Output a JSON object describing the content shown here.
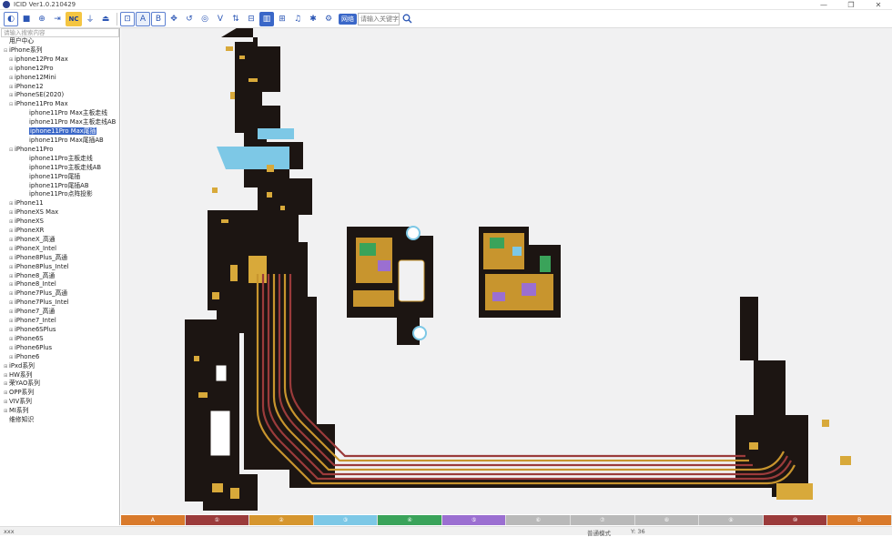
{
  "window": {
    "title": "ICID Ver1.0.210429",
    "buttons": {
      "minimize": "—",
      "restore": "❐",
      "close": "✕"
    }
  },
  "toolbar": {
    "items": [
      {
        "name": "app-logo-icon",
        "glyph": "◐"
      },
      {
        "name": "stop-icon",
        "glyph": "■"
      },
      {
        "name": "ground-icon",
        "glyph": "⊕"
      },
      {
        "name": "trace-icon",
        "glyph": "⇥"
      },
      {
        "name": "nc-button",
        "glyph": "NC"
      },
      {
        "name": "ground-symbol-icon",
        "glyph": "⏚"
      },
      {
        "name": "layer-up-icon",
        "glyph": "⏏"
      },
      {
        "name": "select-icon",
        "glyph": "⊡"
      },
      {
        "name": "side-a-button",
        "glyph": "A"
      },
      {
        "name": "side-b-button",
        "glyph": "B"
      },
      {
        "name": "move-icon",
        "glyph": "✥"
      },
      {
        "name": "rotate-icon",
        "glyph": "↺"
      },
      {
        "name": "target-icon",
        "glyph": "◎"
      },
      {
        "name": "voltage-icon",
        "glyph": "V"
      },
      {
        "name": "swap-icon",
        "glyph": "⇅"
      },
      {
        "name": "component-icon",
        "glyph": "⊟"
      },
      {
        "name": "layers-icon",
        "glyph": "▥"
      },
      {
        "name": "filter-icon",
        "glyph": "⊞"
      },
      {
        "name": "headphone-icon",
        "glyph": "♫"
      },
      {
        "name": "bluetooth-icon",
        "glyph": "✱"
      },
      {
        "name": "settings-icon",
        "glyph": "⚙"
      }
    ],
    "keyword_label": "网络",
    "keyword_placeholder": "请输入关键字",
    "search_icon": "search-icon"
  },
  "sidebar": {
    "search_placeholder": "请输入搜索内容",
    "tree": [
      {
        "label": "用户中心",
        "level": 0,
        "toggle": ""
      },
      {
        "label": "iPhone系列",
        "level": 0,
        "toggle": "⊟"
      },
      {
        "label": "iphone12Pro Max",
        "level": 1,
        "toggle": "⊞"
      },
      {
        "label": "iphone12Pro",
        "level": 1,
        "toggle": "⊞"
      },
      {
        "label": "iphone12Mini",
        "level": 1,
        "toggle": "⊞"
      },
      {
        "label": "iPhone12",
        "level": 1,
        "toggle": "⊞"
      },
      {
        "label": "iPhoneSE(2020)",
        "level": 1,
        "toggle": "⊞"
      },
      {
        "label": "iPhone11Pro Max",
        "level": 1,
        "toggle": "⊟"
      },
      {
        "label": "iphone11Pro Max主板走线",
        "level": 2,
        "toggle": ""
      },
      {
        "label": "iphone11Pro Max主板走线AB",
        "level": 2,
        "toggle": ""
      },
      {
        "label": "iphone11Pro Max尾插",
        "level": 2,
        "toggle": "",
        "selected": true
      },
      {
        "label": "iphone11Pro Max尾插AB",
        "level": 2,
        "toggle": ""
      },
      {
        "label": "iPhone11Pro",
        "level": 1,
        "toggle": "⊟"
      },
      {
        "label": "iphone11Pro主板走线",
        "level": 2,
        "toggle": ""
      },
      {
        "label": "iphone11Pro主板走线AB",
        "level": 2,
        "toggle": ""
      },
      {
        "label": "iphone11Pro尾插",
        "level": 2,
        "toggle": ""
      },
      {
        "label": "iphone11Pro尾插AB",
        "level": 2,
        "toggle": ""
      },
      {
        "label": "iphone11Pro点阵投影",
        "level": 2,
        "toggle": ""
      },
      {
        "label": "iPhone11",
        "level": 1,
        "toggle": "⊞"
      },
      {
        "label": "iPhoneXS Max",
        "level": 1,
        "toggle": "⊞"
      },
      {
        "label": "iPhoneXS",
        "level": 1,
        "toggle": "⊞"
      },
      {
        "label": "iPhoneXR",
        "level": 1,
        "toggle": "⊞"
      },
      {
        "label": "iPhoneX_高通",
        "level": 1,
        "toggle": "⊞"
      },
      {
        "label": "iPhoneX_Intel",
        "level": 1,
        "toggle": "⊞"
      },
      {
        "label": "iPhone8Plus_高通",
        "level": 1,
        "toggle": "⊞"
      },
      {
        "label": "iPhone8Plus_Intel",
        "level": 1,
        "toggle": "⊞"
      },
      {
        "label": "iPhone8_高通",
        "level": 1,
        "toggle": "⊞"
      },
      {
        "label": "iPhone8_Intel",
        "level": 1,
        "toggle": "⊞"
      },
      {
        "label": "iPhone7Plus_高通",
        "level": 1,
        "toggle": "⊞"
      },
      {
        "label": "iPhone7Plus_Intel",
        "level": 1,
        "toggle": "⊞"
      },
      {
        "label": "iPhone7_高通",
        "level": 1,
        "toggle": "⊞"
      },
      {
        "label": "iPhone7_Intel",
        "level": 1,
        "toggle": "⊞"
      },
      {
        "label": "iPhone6SPlus",
        "level": 1,
        "toggle": "⊞"
      },
      {
        "label": "iPhone6S",
        "level": 1,
        "toggle": "⊞"
      },
      {
        "label": "iPhone6Plus",
        "level": 1,
        "toggle": "⊞"
      },
      {
        "label": "iPhone6",
        "level": 1,
        "toggle": "⊞"
      },
      {
        "label": "iPxd系列",
        "level": 0,
        "toggle": "⊞"
      },
      {
        "label": "HW系列",
        "level": 0,
        "toggle": "⊞"
      },
      {
        "label": "荣YAO系列",
        "level": 0,
        "toggle": "⊞"
      },
      {
        "label": "OPP系列",
        "level": 0,
        "toggle": "⊞"
      },
      {
        "label": "VIV系列",
        "level": 0,
        "toggle": "⊞"
      },
      {
        "label": "MI系列",
        "level": 0,
        "toggle": "⊞"
      },
      {
        "label": "维修知识",
        "level": 0,
        "toggle": ""
      }
    ]
  },
  "layer_bar": [
    {
      "label": "A",
      "color": "#d97a2b"
    },
    {
      "label": "①",
      "color": "#9b3b3b"
    },
    {
      "label": "②",
      "color": "#d6962e"
    },
    {
      "label": "③",
      "color": "#7dc8e6"
    },
    {
      "label": "④",
      "color": "#3aa35a"
    },
    {
      "label": "⑤",
      "color": "#9b6fd1"
    },
    {
      "label": "⑥",
      "color": "#b9b9b9"
    },
    {
      "label": "⑦",
      "color": "#b9b9b9"
    },
    {
      "label": "⑧",
      "color": "#b9b9b9"
    },
    {
      "label": "⑨",
      "color": "#b9b9b9"
    },
    {
      "label": "⑩",
      "color": "#9b3b3b"
    },
    {
      "label": "B",
      "color": "#d97a2b"
    }
  ],
  "status": {
    "left": "xxx",
    "mode": "普通模式",
    "coord": "Y: 36"
  },
  "colors": {
    "board": "#1c1512",
    "trace_gold": "#c8952e",
    "trace_red": "#9b3b3b",
    "trace_blue": "#7dc8e6",
    "pad_gold": "#d8a93a",
    "accent": "#3a67c8"
  }
}
